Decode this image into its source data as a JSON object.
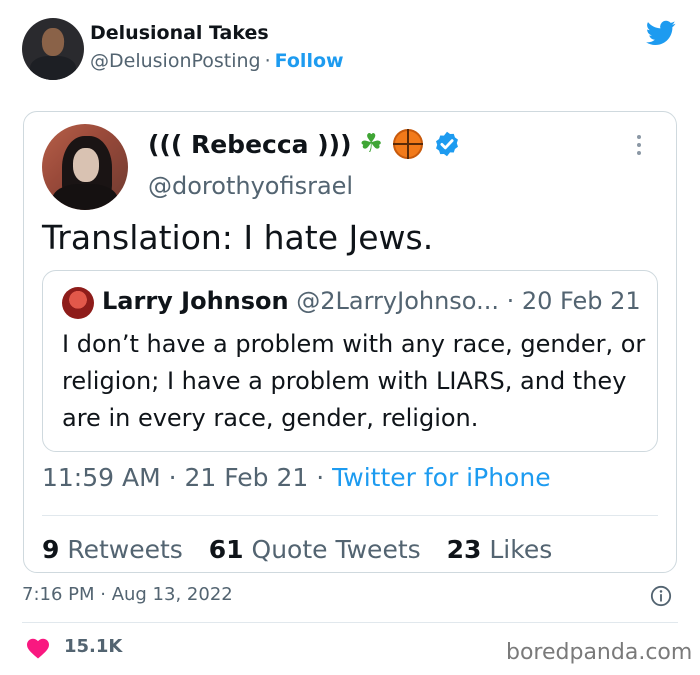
{
  "outer": {
    "name": "Delusional Takes",
    "handle": "@DelusionPosting",
    "separator": "·",
    "follow_label": "Follow",
    "timestamp": "7:16 PM · Aug 13, 2022",
    "likes": "15.1K"
  },
  "inner": {
    "name": "((( Rebecca )))",
    "emoji_shamrock": "☘",
    "handle": "@dorothyofisrael",
    "text": "Translation: I hate Jews.",
    "meta_time": "11:59 AM · 21 Feb 21 · ",
    "source": "Twitter for iPhone",
    "retweets_count": "9",
    "retweets_label": "Retweets",
    "quotes_count": "61",
    "quotes_label": "Quote Tweets",
    "likes_count": "23",
    "likes_label": "Likes"
  },
  "quoted": {
    "name": "Larry Johnson",
    "handle": "@2LarryJohnso...",
    "date": " · 20 Feb 21",
    "text": "I don’t have a problem with any race, gender, or religion; I have a problem with LIARS, and they are in every race, gender, religion."
  },
  "watermark": "boredpanda.com",
  "colors": {
    "twitter_blue": "#1d9bf0",
    "heart_pink": "#f91880",
    "muted_text": "#536471"
  }
}
